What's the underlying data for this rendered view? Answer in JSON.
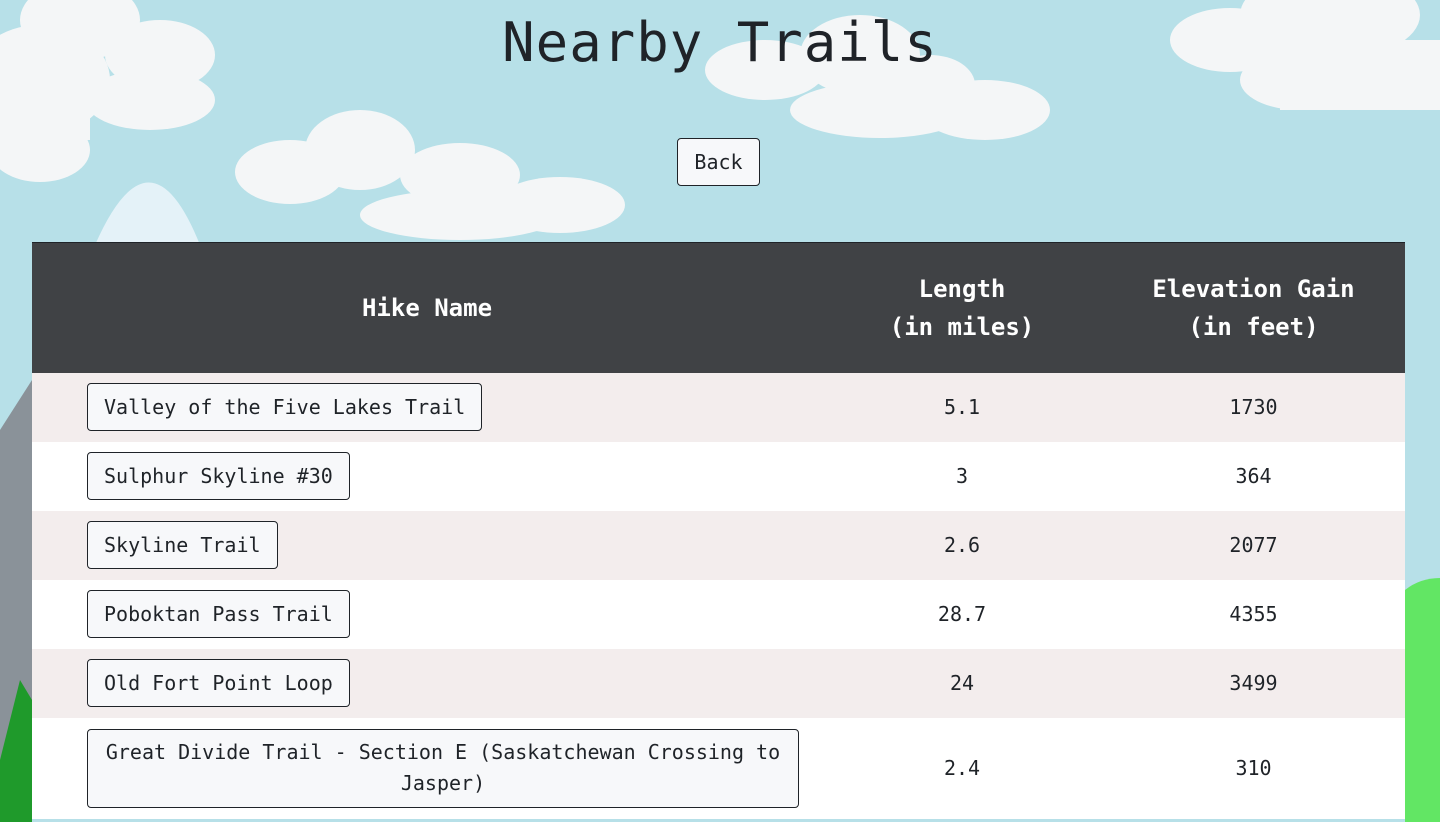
{
  "page": {
    "title": "Nearby Trails",
    "back_label": "Back"
  },
  "table": {
    "headers": {
      "name": "Hike Name",
      "length_line1": "Length",
      "length_line2": "(in miles)",
      "elevation_line1": "Elevation Gain",
      "elevation_line2": "(in feet)"
    },
    "rows": [
      {
        "name": "Valley of the Five Lakes Trail",
        "length": "5.1",
        "elevation": "1730"
      },
      {
        "name": "Sulphur Skyline #30",
        "length": "3",
        "elevation": "364"
      },
      {
        "name": "Skyline Trail",
        "length": "2.6",
        "elevation": "2077"
      },
      {
        "name": "Poboktan Pass Trail",
        "length": "28.7",
        "elevation": "4355"
      },
      {
        "name": "Old Fort Point Loop",
        "length": "24",
        "elevation": "3499"
      },
      {
        "name": "Great Divide Trail - Section E (Saskatchewan Crossing to Jasper)",
        "length": "2.4",
        "elevation": "310"
      }
    ]
  },
  "colors": {
    "sky": "#b7e0e8",
    "cloud": "#f4f6f7",
    "mountain": "#8a9299",
    "snowcap": "#e4f2f8",
    "tree": "#1f9a2b",
    "grass": "#62e664",
    "header_bg": "#404245",
    "row_odd": "#f3eded",
    "row_even": "#ffffff"
  }
}
